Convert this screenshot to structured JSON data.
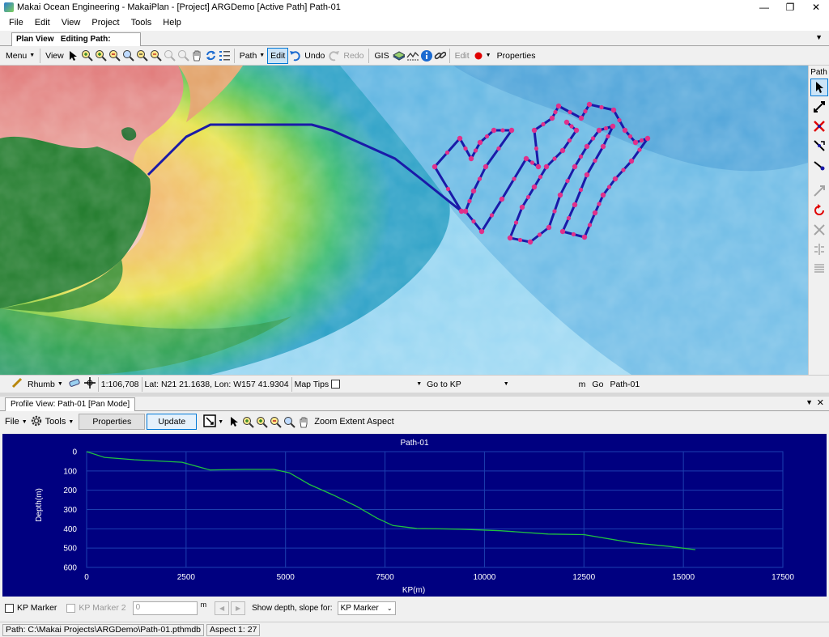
{
  "window": {
    "title": "Makai Ocean Engineering - MakaiPlan - [Project] ARGDemo [Active Path] Path-01"
  },
  "menu": [
    "File",
    "Edit",
    "View",
    "Project",
    "Tools",
    "Help"
  ],
  "plan_tabs": {
    "plan_view": "Plan View",
    "editing": "Editing Path: Path-..."
  },
  "toolbar": {
    "menu": "Menu",
    "view": "View",
    "path": "Path",
    "edit": "Edit",
    "undo": "Undo",
    "redo": "Redo",
    "gis": "GIS",
    "edit2": "Edit",
    "properties": "Properties"
  },
  "sidebar": {
    "label": "Path"
  },
  "map_status": {
    "rhumb": "Rhumb",
    "scale": "1:106,708",
    "latlon": "Lat: N21 21.1638, Lon: W157 41.9304",
    "map_tips": "Map Tips",
    "goto": "Go to KP",
    "unit": "m",
    "go": "Go",
    "path_name": "Path-01"
  },
  "profile": {
    "tab": "Profile View: Path-01 [Pan Mode]",
    "file": "File",
    "tools": "Tools",
    "properties": "Properties",
    "update": "Update",
    "zoom_extent": "Zoom Extent Aspect"
  },
  "kp": {
    "kp_marker": "KP Marker",
    "kp_marker2": "KP Marker 2",
    "kp_value": "0",
    "unit": "m",
    "show_label": "Show depth, slope for:",
    "select_value": "KP Marker"
  },
  "status": {
    "path": "Path: C:\\Makai Projects\\ARGDemo\\Path-01.pthmdb",
    "aspect": "Aspect 1: 27"
  },
  "colors": {
    "path": "#1a1aa8",
    "vertex": "#e0308a",
    "chart_bg": "#000080",
    "profile_line": "#20c040"
  },
  "chart_data": {
    "type": "line",
    "title": "Path-01",
    "xlabel": "KP(m)",
    "ylabel": "Depth(m)",
    "xlim": [
      0,
      17500
    ],
    "ylim": [
      0,
      600
    ],
    "y_inverted": true,
    "x_ticks": [
      0,
      2500,
      5000,
      7500,
      10000,
      12500,
      15000,
      17500
    ],
    "y_ticks": [
      0,
      100,
      200,
      300,
      400,
      500,
      600
    ],
    "grid": true,
    "series": [
      {
        "x": [
          0,
          450,
          1200,
          2400,
          3100,
          4000,
          4700,
          5100,
          5600,
          6200,
          6800,
          7300,
          7700,
          8300,
          9400,
          10400,
          11600,
          12500,
          13700,
          14600,
          15300
        ],
        "y": [
          0,
          30,
          42,
          55,
          95,
          92,
          92,
          110,
          170,
          225,
          285,
          345,
          383,
          398,
          402,
          410,
          427,
          430,
          472,
          490,
          508
        ]
      }
    ]
  }
}
